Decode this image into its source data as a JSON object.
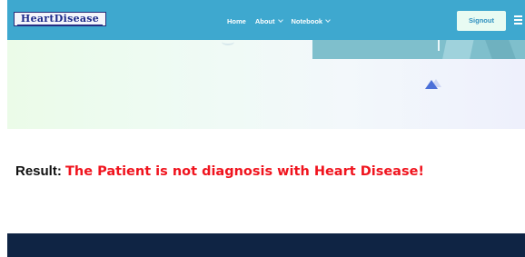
{
  "brand": {
    "logo_text": "HeartDisease"
  },
  "nav": {
    "items": [
      {
        "label": "Home",
        "has_dropdown": false
      },
      {
        "label": "About",
        "has_dropdown": true
      },
      {
        "label": "Notebook",
        "has_dropdown": true
      }
    ],
    "signout_label": "Signout"
  },
  "result": {
    "label": "Result:",
    "value": "The Patient is not diagnosis with Heart Disease!"
  },
  "colors": {
    "navbar": "#3ea8cf",
    "result_text": "#f0141e",
    "footer": "#0f2444",
    "signout_bg": "#e8fbf2"
  },
  "icons": [
    "menu-icon",
    "chevron-down-icon"
  ]
}
